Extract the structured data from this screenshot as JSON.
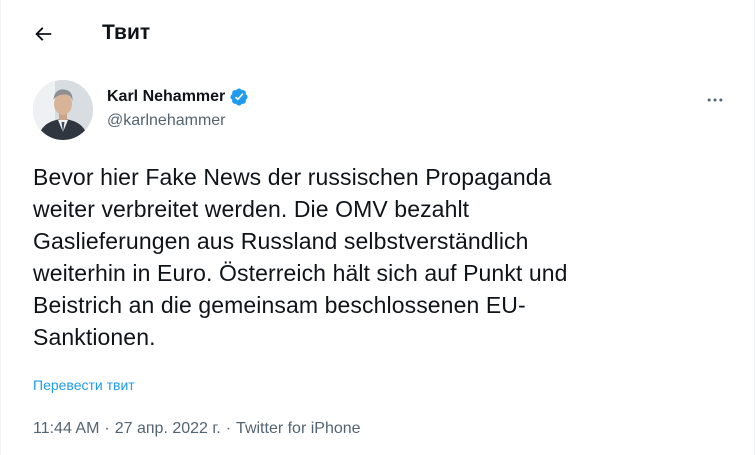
{
  "header": {
    "title": "Твит",
    "back_icon": "arrow-left-icon"
  },
  "author": {
    "display_name": "Karl Nehammer",
    "handle": "@karlnehammer",
    "verified_icon": "verified-badge-icon",
    "verified_color": "#1d9bf0"
  },
  "tweet": {
    "text": "Bevor hier Fake News der russischen Propaganda weiter verbreitet werden. Die OMV bezahlt Gaslieferungen aus Russland selbstverständlich weiterhin in Euro. Österreich hält sich auf Punkt und Beistrich an die gemeinsam beschlossenen EU-Sanktionen.",
    "lines": [
      "Bevor hier Fake News der russischen Propaganda",
      "weiter verbreitet werden. Die OMV bezahlt",
      "Gaslieferungen aus Russland selbstverständlich",
      "weiterhin in Euro. Österreich hält sich auf Punkt und",
      "Beistrich an die gemeinsam beschlossenen EU-",
      "Sanktionen."
    ],
    "translate_label": "Перевести твит"
  },
  "meta": {
    "time": "11:44 AM",
    "separator": "·",
    "date": "27 апр. 2022 г.",
    "source": "Twitter for iPhone"
  },
  "more_icon": "more-horizontal-icon",
  "colors": {
    "accent": "#1d9bf0",
    "text_primary": "#0f1419",
    "text_secondary": "#536471"
  }
}
